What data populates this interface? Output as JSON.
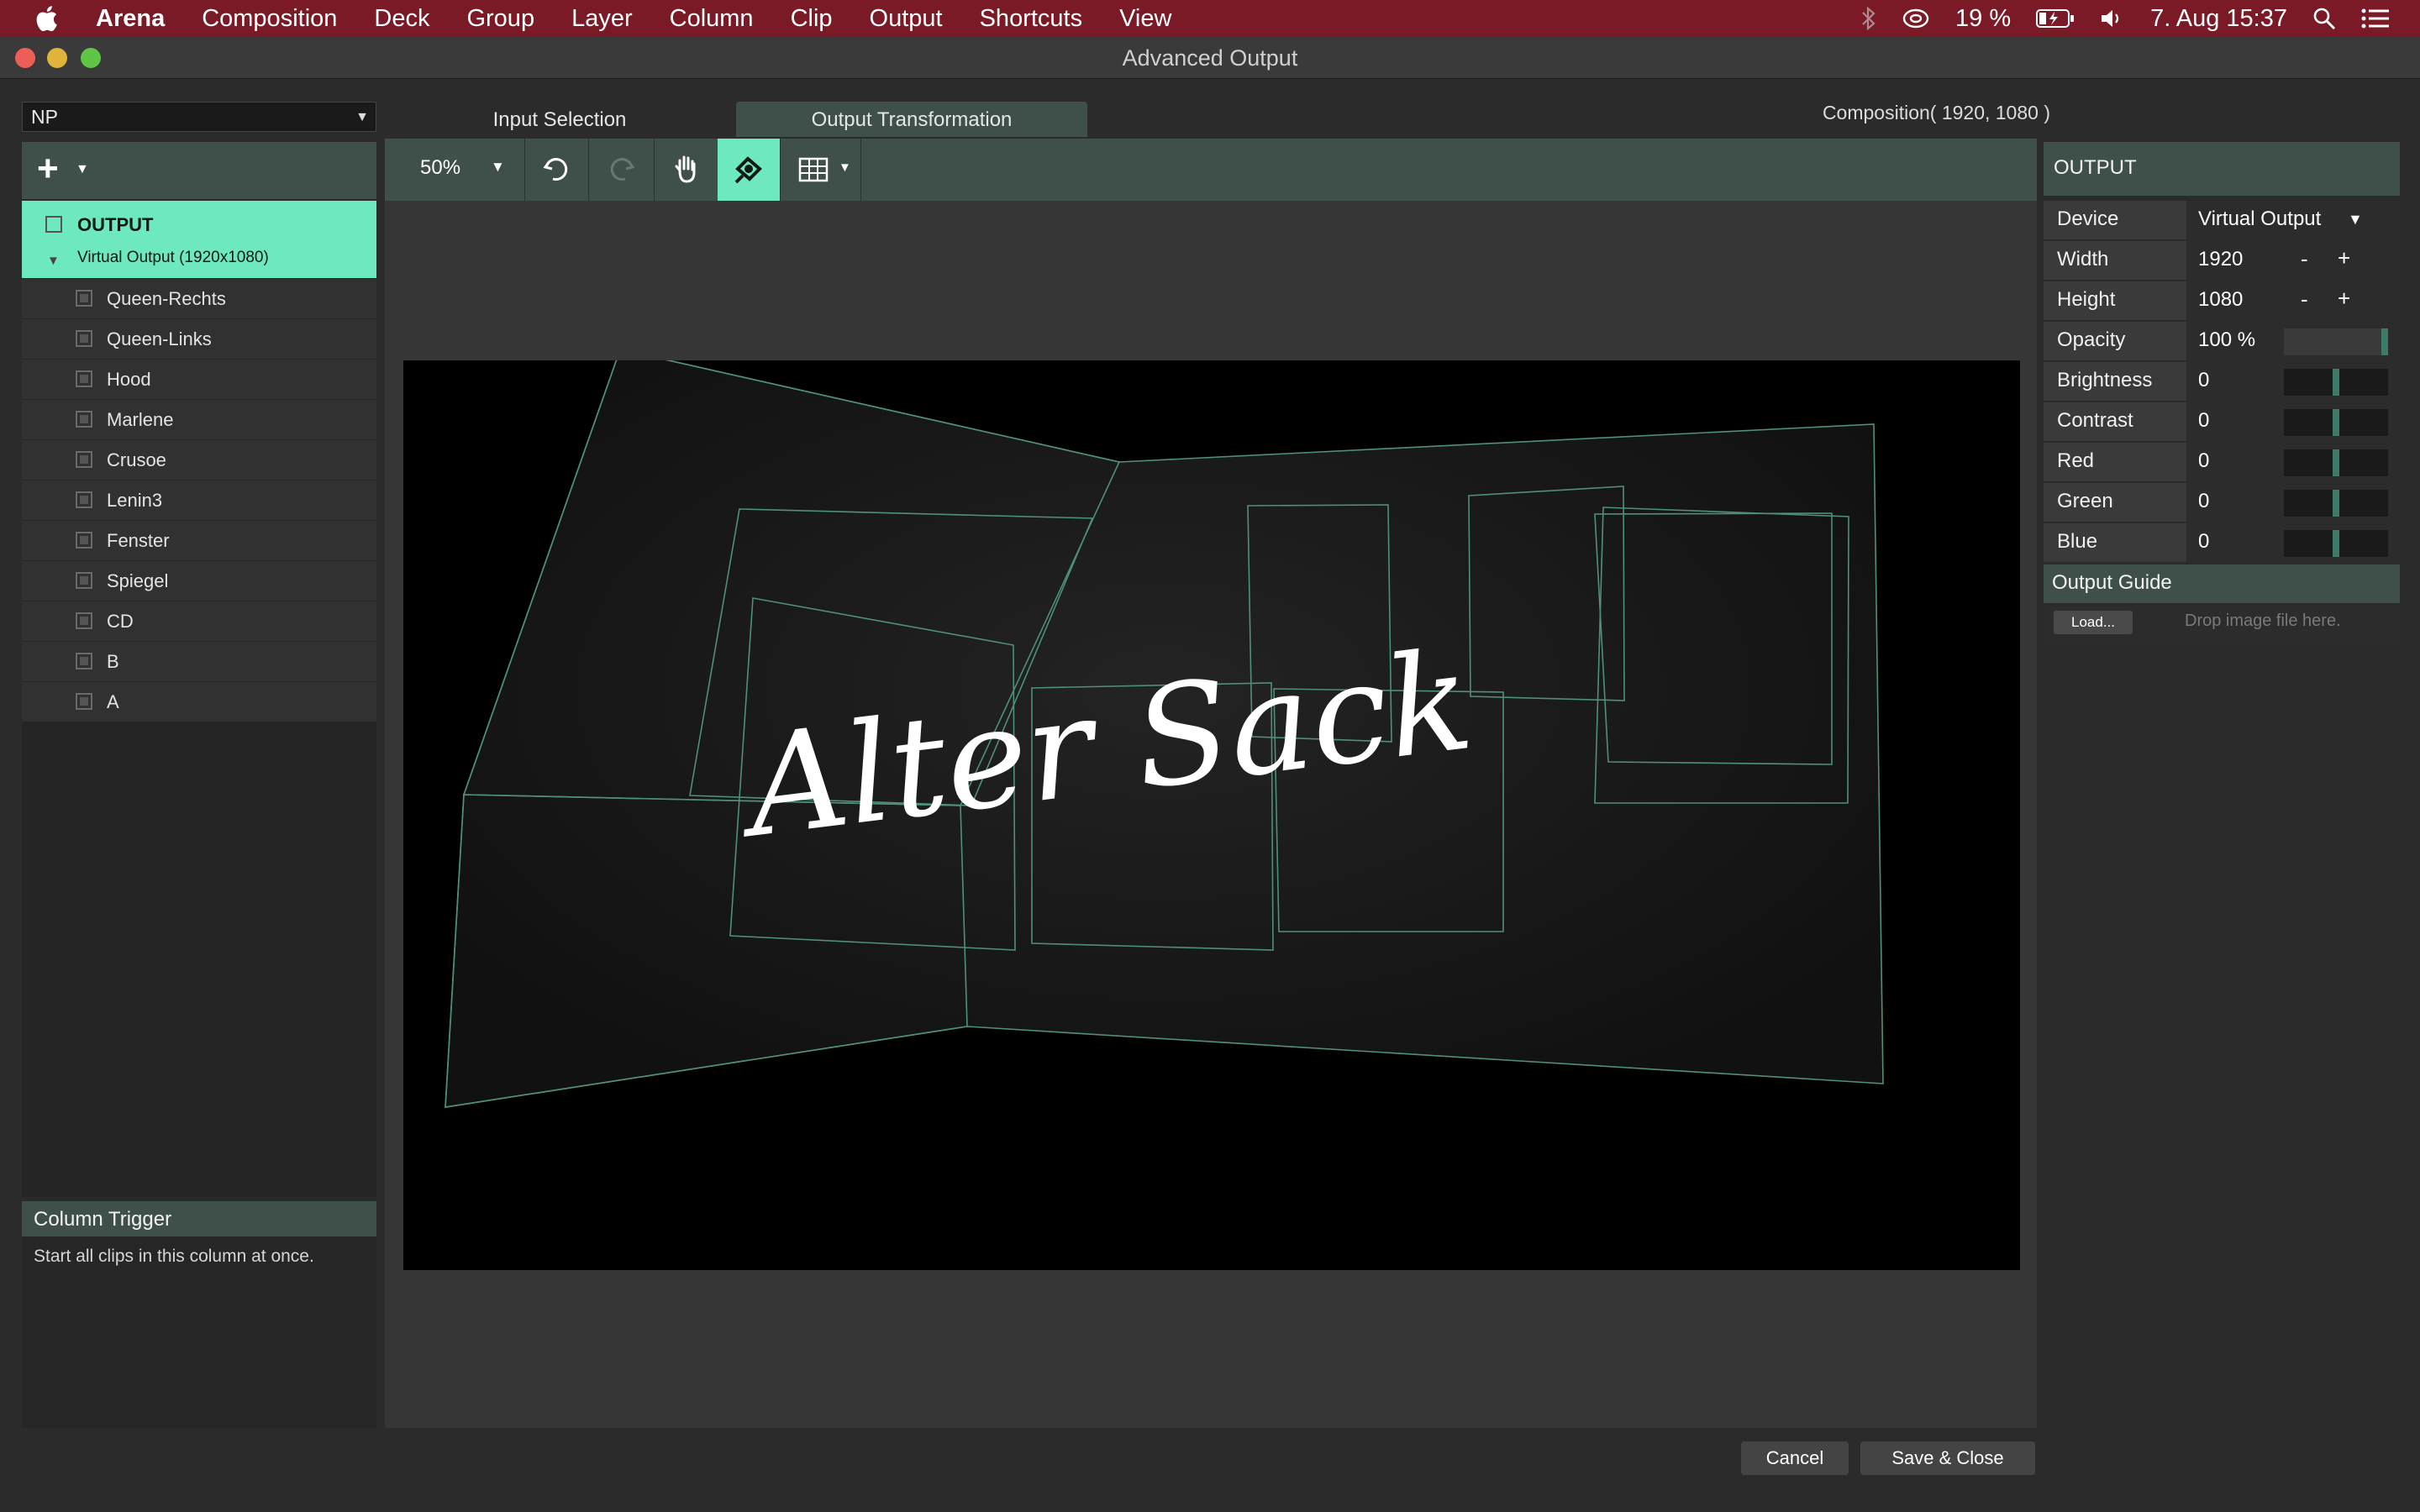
{
  "menubar": {
    "app_name": "Arena",
    "items": [
      "Composition",
      "Deck",
      "Group",
      "Layer",
      "Column",
      "Clip",
      "Output",
      "Shortcuts",
      "View"
    ],
    "battery": "19 %",
    "datetime": "7. Aug  15:37"
  },
  "window": {
    "title": "Advanced Output"
  },
  "left": {
    "preset": "NP",
    "output_node": {
      "label": "OUTPUT",
      "device": "Virtual Output (1920x1080)"
    },
    "screens": [
      "Queen-Rechts",
      "Queen-Links",
      "Hood",
      "Marlene",
      "Crusoe",
      "Lenin3",
      "Fenster",
      "Spiegel",
      "CD",
      "B",
      "A"
    ]
  },
  "tabs": {
    "input": "Input Selection",
    "output": "Output Transformation"
  },
  "composition_label": "Composition( 1920, 1080 )",
  "toolbar": {
    "zoom": "50%"
  },
  "stage": {
    "overlay_text": "Alter Sack"
  },
  "right": {
    "header": "OUTPUT",
    "device": {
      "label": "Device",
      "value": "Virtual Output"
    },
    "width": {
      "label": "Width",
      "value": "1920"
    },
    "height": {
      "label": "Height",
      "value": "1080"
    },
    "opacity": {
      "label": "Opacity",
      "value": "100 %",
      "level": 1.0
    },
    "brightness": {
      "label": "Brightness",
      "value": "0",
      "level": 0.5
    },
    "contrast": {
      "label": "Contrast",
      "value": "0",
      "level": 0.5
    },
    "red": {
      "label": "Red",
      "value": "0",
      "level": 0.5
    },
    "green": {
      "label": "Green",
      "value": "0",
      "level": 0.5
    },
    "blue": {
      "label": "Blue",
      "value": "0",
      "level": 0.5
    },
    "minus": "-",
    "plus": "+",
    "guide": {
      "header": "Output Guide",
      "load": "Load...",
      "drop": "Drop image file here."
    }
  },
  "column_trigger": {
    "title": "Column Trigger",
    "description": "Start all clips in this column at once."
  },
  "buttons": {
    "cancel": "Cancel",
    "save": "Save & Close"
  },
  "colors": {
    "accent": "#6ee8be",
    "menubar": "#7a1a26",
    "panel_header": "#3f4f4a",
    "slider_handle": "#3e7a6a"
  }
}
